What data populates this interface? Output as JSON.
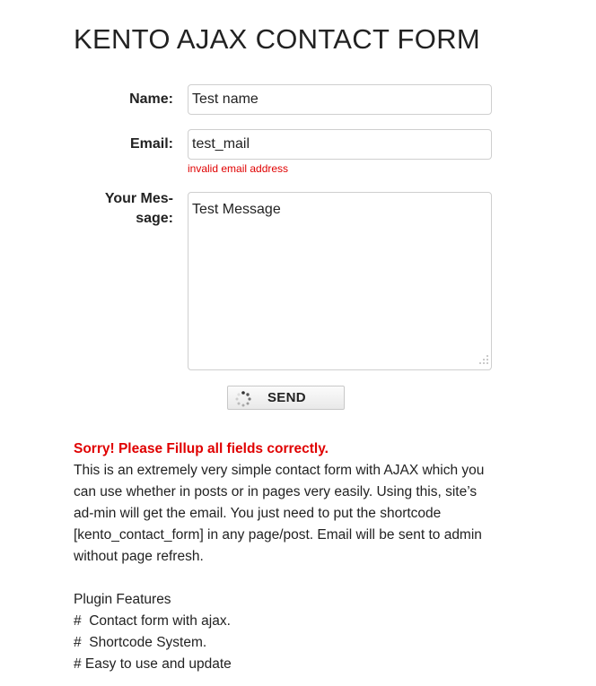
{
  "title": "KENTO AJAX CONTACT FORM",
  "form": {
    "name_label": "Name:",
    "name_value": "Test name",
    "email_label": "Email:",
    "email_value": "test_mail",
    "email_error": "invalid email address",
    "message_label_line1": "Your Mes-",
    "message_label_line2": "sage:",
    "message_value": "Test Message",
    "send_label": "SEND"
  },
  "status": {
    "error_message": "Sorry! Please Fillup all fields correctly.",
    "error_color": "#e00000"
  },
  "content": {
    "description": "This is an extremely very simple contact form with AJAX which you can use whether in posts or in pages very easily. Using this, site’s ad-min will get the email. You just need to put the shortcode [kento_contact_form] in any page/post. Email will be sent to admin without page refresh.",
    "features_title": "Plugin Features",
    "features": [
      "#  Contact form with ajax.",
      "#  Shortcode System.",
      "# Easy to use and update"
    ]
  },
  "icons": {
    "spinner": "loading-spinner-icon",
    "grip": "resize-grip-icon"
  }
}
